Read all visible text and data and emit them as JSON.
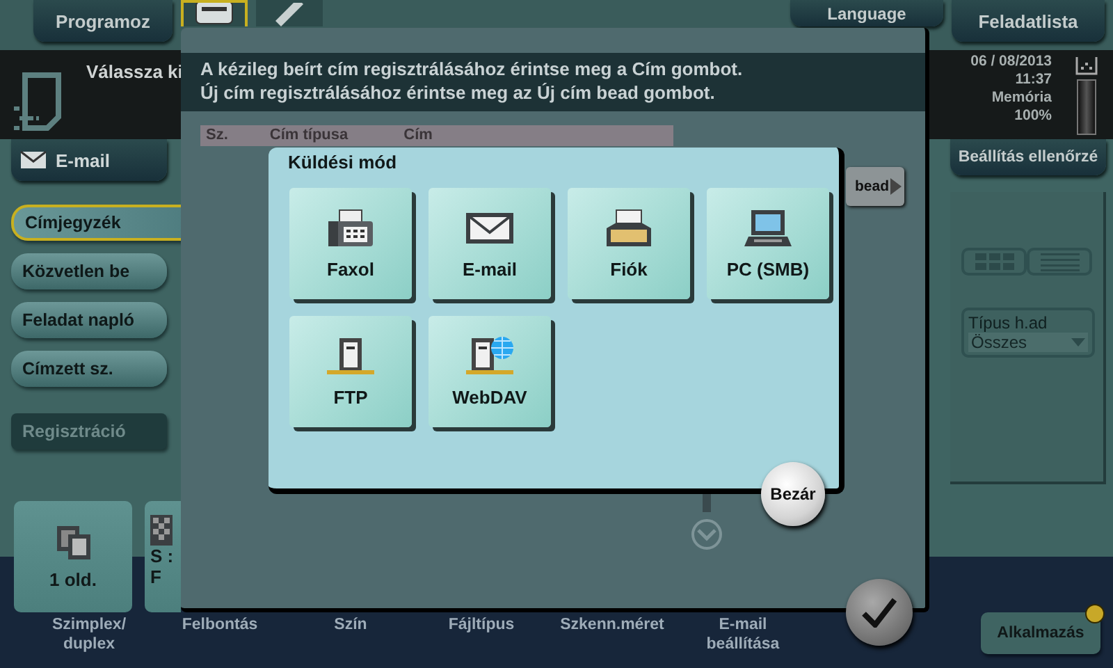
{
  "top_bar": {
    "program_button": "Programoz",
    "tabs": [
      {
        "kind": "address",
        "selected": true
      },
      {
        "kind": "pen",
        "selected": false
      }
    ],
    "language_button": "Language",
    "job_list_button": "Feladatlista"
  },
  "message_bar": {
    "text": "Válassza ki"
  },
  "status": {
    "date": "06 / 08/2013",
    "time": "11:37",
    "memory_label": "Memória",
    "memory_value": "100%"
  },
  "mode_button": "E-mail",
  "check_settings_button": "Beállítás ellenőrzé",
  "sidebar": {
    "items": [
      {
        "label": "Címjegyzék",
        "selected": true,
        "disabled": false
      },
      {
        "label": "Közvetlen be",
        "selected": false,
        "disabled": false
      },
      {
        "label": "Feladat napló",
        "selected": false,
        "disabled": false
      },
      {
        "label": "Címzett sz.",
        "selected": false,
        "disabled": false
      },
      {
        "label": "Regisztráció",
        "selected": false,
        "disabled": true
      }
    ]
  },
  "type_filter": {
    "label": "Típus h.ad",
    "value": "Összes"
  },
  "bottom_tiles": [
    {
      "kind": "duplex",
      "lines": [
        "1 old."
      ]
    },
    {
      "kind": "resolution",
      "lines": [
        "S :",
        "F"
      ]
    }
  ],
  "function_labels": [
    {
      "lines": [
        "Szimplex/",
        "duplex"
      ]
    },
    {
      "lines": [
        "Felbontás"
      ]
    },
    {
      "lines": [
        "Szín"
      ]
    },
    {
      "lines": [
        "Fájltípus"
      ]
    },
    {
      "lines": [
        "Szkenn.méret"
      ]
    },
    {
      "lines": [
        "E-mail",
        "beállítása"
      ]
    }
  ],
  "apps_button": {
    "label": "Alkalmazás",
    "notification": true
  },
  "dialog": {
    "message": [
      "A kézileg beírt cím regisztrálásához érintse meg a Cím gombot.",
      "Új cím regisztrálásához érintse meg az Új cím bead gombot."
    ],
    "table": {
      "columns": [
        "Sz.",
        "Cím típusa",
        "Cím"
      ]
    },
    "new_address_button": "bead"
  },
  "send_mode": {
    "title": "Küldési mód",
    "options": [
      {
        "kind": "fax",
        "label": "Faxol"
      },
      {
        "kind": "email",
        "label": "E-mail"
      },
      {
        "kind": "box",
        "label": "Fiók"
      },
      {
        "kind": "pc",
        "label": "PC (SMB)"
      },
      {
        "kind": "ftp",
        "label": "FTP"
      },
      {
        "kind": "webdav",
        "label": "WebDAV"
      }
    ],
    "close_button": "Bezár"
  }
}
